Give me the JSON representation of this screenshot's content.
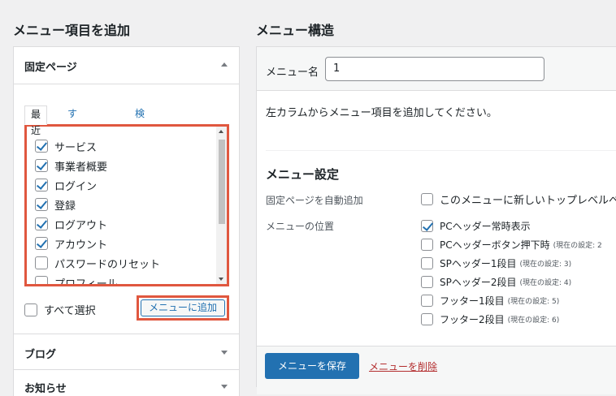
{
  "left_heading": "メニュー項目を追加",
  "right_heading": "メニュー構造",
  "sections": {
    "pages": "固定ページ",
    "blog": "ブログ",
    "news": "お知らせ"
  },
  "tabs": [
    "最近",
    "すべて表示",
    "検索"
  ],
  "page_items": [
    {
      "label": "サービス",
      "checked": true
    },
    {
      "label": "事業者概要",
      "checked": true
    },
    {
      "label": "ログイン",
      "checked": true
    },
    {
      "label": "登録",
      "checked": true
    },
    {
      "label": "ログアウト",
      "checked": true
    },
    {
      "label": "アカウント",
      "checked": true
    },
    {
      "label": "パスワードのリセット",
      "checked": false
    },
    {
      "label": "プロフィール",
      "checked": false
    }
  ],
  "select_all_label": "すべて選択",
  "add_to_menu_label": "メニューに追加",
  "menu_name_label": "メニュー名",
  "menu_name_value": "1",
  "instruction": "左カラムからメニュー項目を追加してください。",
  "settings_title": "メニュー設定",
  "auto_add_label": "固定ページを自動追加",
  "auto_add_option": "このメニューに新しいトップレベルペ",
  "location_label": "メニューの位置",
  "locations": [
    {
      "label": "PCヘッダー常時表示",
      "current": "",
      "checked": true
    },
    {
      "label": "PCヘッダーボタン押下時",
      "current": "(現在の設定: 2",
      "checked": false
    },
    {
      "label": "SPヘッダー1段目",
      "current": "(現在の設定: 3)",
      "checked": false
    },
    {
      "label": "SPヘッダー2段目",
      "current": "(現在の設定: 4)",
      "checked": false
    },
    {
      "label": "フッター1段目",
      "current": "(現在の設定: 5)",
      "checked": false
    },
    {
      "label": "フッター2段目",
      "current": "(現在の設定: 6)",
      "checked": false
    }
  ],
  "save_label": "メニューを保存",
  "delete_label": "メニューを削除"
}
